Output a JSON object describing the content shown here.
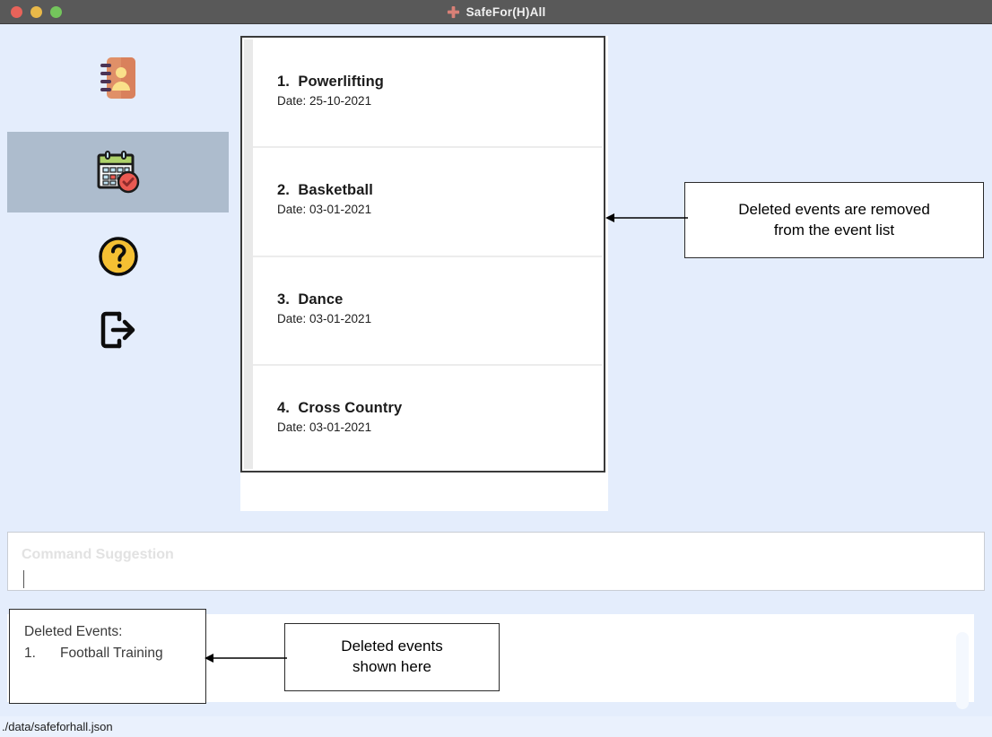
{
  "window": {
    "title": "SafeFor(H)All",
    "icon": "cross-icon",
    "controls": [
      "close",
      "minimize",
      "maximize"
    ]
  },
  "sidebar": {
    "items": [
      {
        "key": "contacts",
        "icon": "address-book-icon",
        "label": "Contacts",
        "selected": false
      },
      {
        "key": "events",
        "icon": "calendar-check-icon",
        "label": "Events",
        "selected": true
      },
      {
        "key": "help",
        "icon": "question-circle-icon",
        "label": "Help",
        "selected": false
      },
      {
        "key": "exit",
        "icon": "logout-icon",
        "label": "Exit",
        "selected": false
      }
    ],
    "selected_color": "#adbccd"
  },
  "event_list": {
    "events": [
      {
        "index": "1.",
        "name": "Powerlifting",
        "date_label": "Date: 25-10-2021"
      },
      {
        "index": "2.",
        "name": "Basketball",
        "date_label": "Date: 03-01-2021"
      },
      {
        "index": "3.",
        "name": "Dance",
        "date_label": "Date: 03-01-2021"
      },
      {
        "index": "4.",
        "name": "Cross Country",
        "date_label": "Date: 03-01-2021"
      }
    ]
  },
  "command_box": {
    "placeholder": "Command Suggestion",
    "value": ""
  },
  "result_panel": {
    "heading": "Deleted Events:",
    "items": [
      {
        "index": "1.",
        "name": "Football Training"
      }
    ]
  },
  "status_bar": {
    "file_path": "./data/safeforhall.json"
  },
  "annotations": [
    {
      "key": "removed",
      "line1": "Deleted events are removed",
      "line2": "from the event list"
    },
    {
      "key": "shown",
      "line1": "Deleted events",
      "line2": "shown here"
    }
  ],
  "colors": {
    "background": "#e4edfc",
    "titlebar": "#595959",
    "selected_item": "#adbccd",
    "traffic_red": "#e8635a",
    "traffic_yellow": "#e9b949",
    "traffic_green": "#74c55c",
    "panel_white": "#ffffff",
    "annotation_border": "#2b2b2b"
  }
}
